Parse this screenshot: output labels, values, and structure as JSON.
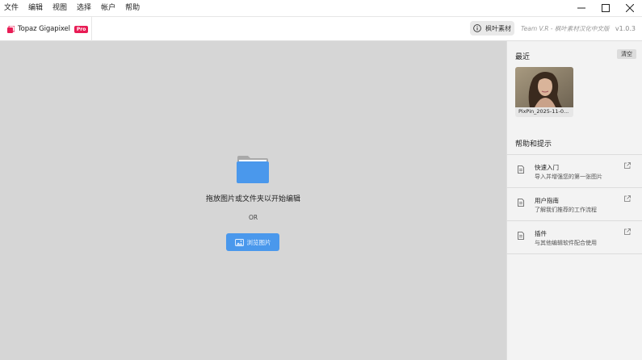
{
  "menu": {
    "items": [
      "文件",
      "编辑",
      "视图",
      "选择",
      "帐户",
      "帮助"
    ]
  },
  "header": {
    "brand": "Topaz Gigapixel",
    "badge": "Pro",
    "maple_button": "枫叶素材",
    "team_text": "Team V.R - 枫叶素材汉化中文版",
    "version": "v1.0.3"
  },
  "main": {
    "drop_text": "拖放图片或文件夹以开始编辑",
    "or_text": "OR",
    "browse_label": "浏览图片"
  },
  "side": {
    "recent_title": "最近",
    "clear_label": "清空",
    "recent_files": [
      {
        "name": "PixPin_2025-11-0..."
      }
    ],
    "help_title": "帮助和提示",
    "help_items": [
      {
        "title": "快速入门",
        "subtitle": "导入并增强您的第一张图片"
      },
      {
        "title": "用户指南",
        "subtitle": "了解我们推荐的工作流程"
      },
      {
        "title": "插件",
        "subtitle": "与其他编辑软件配合使用"
      }
    ]
  },
  "colors": {
    "accent": "#4a98ec",
    "badge": "#e81c55",
    "drop_bg": "#d6d6d6",
    "side_bg": "#f3f3f3"
  }
}
